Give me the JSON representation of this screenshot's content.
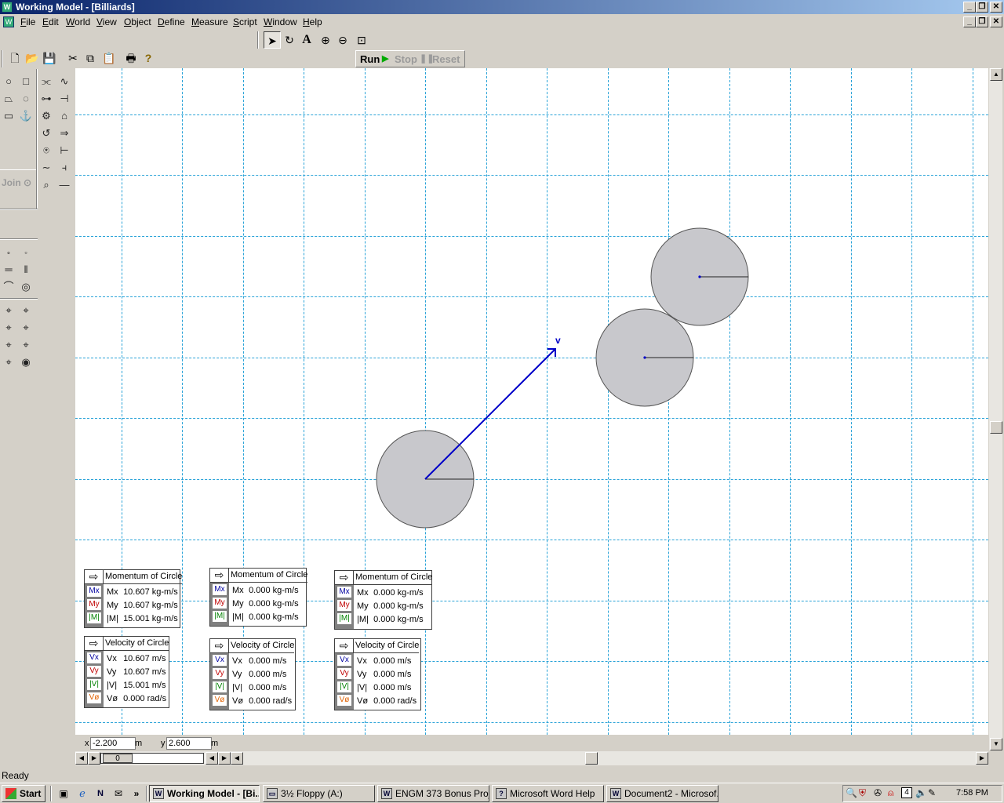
{
  "window": {
    "title": "Working Model - [Billiards]",
    "app_icon": "working-model-icon"
  },
  "menu": [
    "File",
    "Edit",
    "World",
    "View",
    "Object",
    "Define",
    "Measure",
    "Script",
    "Window",
    "Help"
  ],
  "toolbar": {
    "run_label": "Run",
    "stop_label": "Stop",
    "reset_label": "Reset"
  },
  "palette": {
    "join_label": "Join"
  },
  "canvas": {
    "velocity_label": "v",
    "colors": {
      "grid": "#2aa3d8",
      "ball_fill": "#c8c8cc",
      "vector": "#0000c8"
    }
  },
  "meters": [
    {
      "momentum": {
        "title": "Momentum of Circle",
        "rows": [
          {
            "label": "Mx",
            "value": "10.607 kg-m/s"
          },
          {
            "label": "My",
            "value": "10.607 kg-m/s"
          },
          {
            "label": "|M|",
            "value": "15.001 kg-m/s"
          }
        ]
      },
      "velocity": {
        "title": "Velocity of Circle",
        "rows": [
          {
            "label": "Vx",
            "value": "10.607 m/s"
          },
          {
            "label": "Vy",
            "value": "10.607 m/s"
          },
          {
            "label": "|V|",
            "value": "15.001 m/s"
          },
          {
            "label": "Vø",
            "value": "0.000 rad/s"
          }
        ]
      }
    },
    {
      "momentum": {
        "title": "Momentum of Circle",
        "rows": [
          {
            "label": "Mx",
            "value": "0.000 kg-m/s"
          },
          {
            "label": "My",
            "value": "0.000 kg-m/s"
          },
          {
            "label": "|M|",
            "value": "0.000 kg-m/s"
          }
        ]
      },
      "velocity": {
        "title": "Velocity of Circle",
        "rows": [
          {
            "label": "Vx",
            "value": "0.000 m/s"
          },
          {
            "label": "Vy",
            "value": "0.000 m/s"
          },
          {
            "label": "|V|",
            "value": "0.000 m/s"
          },
          {
            "label": "Vø",
            "value": "0.000 rad/s"
          }
        ]
      }
    },
    {
      "momentum": {
        "title": "Momentum of Circle",
        "rows": [
          {
            "label": "Mx",
            "value": "0.000 kg-m/s"
          },
          {
            "label": "My",
            "value": "0.000 kg-m/s"
          },
          {
            "label": "|M|",
            "value": "0.000 kg-m/s"
          }
        ]
      },
      "velocity": {
        "title": "Velocity of Circle",
        "rows": [
          {
            "label": "Vx",
            "value": "0.000 m/s"
          },
          {
            "label": "Vy",
            "value": "0.000 m/s"
          },
          {
            "label": "|V|",
            "value": "0.000 m/s"
          },
          {
            "label": "Vø",
            "value": "0.000 rad/s"
          }
        ]
      }
    }
  ],
  "chips": {
    "mx": "Mx",
    "my": "My",
    "m": "|M|",
    "vx": "Vx",
    "vy": "Vy",
    "v": "|V|",
    "vo": "Vø"
  },
  "chip_colors": {
    "x": "#0000a0",
    "y": "#c00000",
    "mag": "#008000",
    "rot": "#e06000"
  },
  "coords": {
    "x_label": "x",
    "x_value": "-2.200",
    "x_unit": "m",
    "y_label": "y",
    "y_value": "2.600",
    "y_unit": "m"
  },
  "frame": {
    "value": "0"
  },
  "status": {
    "text": "Ready"
  },
  "taskbar": {
    "start": "Start",
    "tasks": [
      "Working Model - [Bi...",
      "3½ Floppy (A:)",
      "ENGM 373 Bonus Proj...",
      "Microsoft Word Help",
      "Document2 - Microsof..."
    ],
    "clock": "7:58 PM"
  }
}
